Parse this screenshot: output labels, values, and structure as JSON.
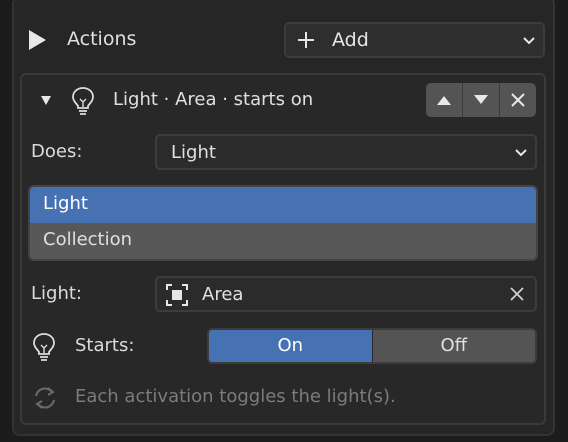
{
  "header": {
    "actions_label": "Actions",
    "add_label": "Add"
  },
  "item": {
    "title": "Light · Area · starts on",
    "does_label": "Does:",
    "does_value": "Light",
    "options": [
      "Light",
      "Collection"
    ],
    "light_label": "Light:",
    "light_value": "Area",
    "starts_label": "Starts:",
    "starts_on": "On",
    "starts_off": "Off",
    "hint": "Each activation toggles the light(s)."
  },
  "colors": {
    "accent": "#4672b4",
    "panel": "#282828",
    "background": "#1c1c1c"
  },
  "icons": [
    "play-icon",
    "plus-icon",
    "chevron-down-icon",
    "disclosure-triangle-icon",
    "lightbulb-icon",
    "arrow-up-icon",
    "arrow-down-icon",
    "close-icon",
    "object-select-icon",
    "refresh-icon"
  ]
}
